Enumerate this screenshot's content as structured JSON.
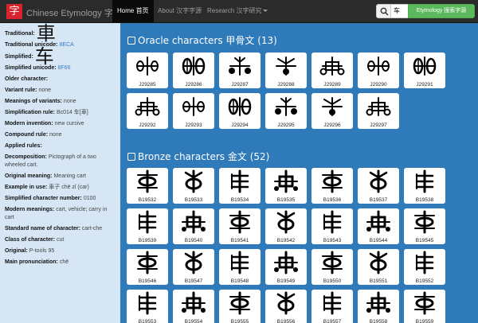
{
  "nav": {
    "logo_char": "字",
    "brand": "Chinese Etymology 字源",
    "items": [
      {
        "label": "Home 首页",
        "active": true
      },
      {
        "label": "About 汉字字源",
        "active": false
      },
      {
        "label": "Research 汉字研究",
        "active": false
      }
    ],
    "search_value": "车",
    "etymology_button": "Etymology 搜索字源"
  },
  "sidebar": {
    "traditional_label": "Traditional:",
    "traditional_char": "車",
    "traditional_unicode_label": "Traditional unicode:",
    "traditional_unicode": "8ECA",
    "simplified_label": "Simplified:",
    "simplified_char": "车",
    "rows": [
      {
        "label": "Simplified unicode:",
        "value": "8F66",
        "link": true
      },
      {
        "label": "Older character:",
        "value": ""
      },
      {
        "label": "Variant rule:",
        "value": "none"
      },
      {
        "label": "Meanings of variants:",
        "value": "none"
      },
      {
        "label": "Simplification rule:",
        "value": "Bc014 车[車]"
      },
      {
        "label": "Modern invention:",
        "value": "new cursive"
      },
      {
        "label": "Compound rule:",
        "value": "none"
      },
      {
        "label": "Applied rules:",
        "value": ""
      },
      {
        "label": "Decomposition:",
        "value": "Pictograph of a two wheeled cart."
      },
      {
        "label": "Original meaning:",
        "value": "Meaning cart"
      },
      {
        "label": "Example in use:",
        "value": "車子 chē zǐ (car)"
      },
      {
        "label": "Simplified character number:",
        "value": "0100"
      },
      {
        "label": "Modern meanings:",
        "value": "cart, vehicle; carry in cart"
      },
      {
        "label": "Standard name of character:",
        "value": "cart-che"
      },
      {
        "label": "Class of character:",
        "value": "cut"
      },
      {
        "label": "Original:",
        "value": "P-tools 95"
      },
      {
        "label": "Main pronunciation:",
        "value": "chē"
      }
    ]
  },
  "oracle": {
    "title": "Oracle characters 甲骨文 (13)",
    "items": [
      "J29285",
      "J29286",
      "J29287",
      "J29288",
      "J29289",
      "J29290",
      "J29291",
      "J29292",
      "J29293",
      "J29294",
      "J29295",
      "J29296",
      "J29297"
    ]
  },
  "bronze": {
    "title": "Bronze characters 金文 (52)",
    "items": [
      "B19532",
      "B19533",
      "B19534",
      "B19535",
      "B19536",
      "B19537",
      "B19538",
      "B19539",
      "B19540",
      "B19541",
      "B19542",
      "B19543",
      "B19544",
      "B19545",
      "B19546",
      "B19547",
      "B19548",
      "B19549",
      "B19550",
      "B19551",
      "B19552",
      "B19553",
      "B19554",
      "B19555",
      "B19556",
      "B19557",
      "B19558",
      "B19559"
    ]
  }
}
